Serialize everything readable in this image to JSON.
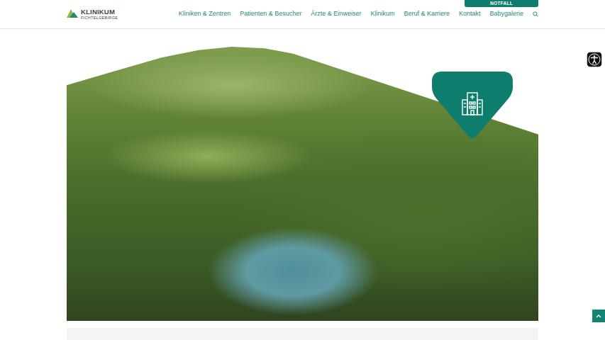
{
  "logo": {
    "name": "KLINIKUM",
    "subtitle": "FICHTELGEBIRGE"
  },
  "emergency": {
    "label": "NOTFALL"
  },
  "nav": {
    "items": [
      {
        "label": "Kliniken & Zentren"
      },
      {
        "label": "Patienten & Besucher"
      },
      {
        "label": "Ärzte & Einweiser"
      },
      {
        "label": "Klinikum"
      },
      {
        "label": "Beruf & Karriere"
      },
      {
        "label": "Kontakt"
      },
      {
        "label": "Babygalerie"
      }
    ]
  }
}
